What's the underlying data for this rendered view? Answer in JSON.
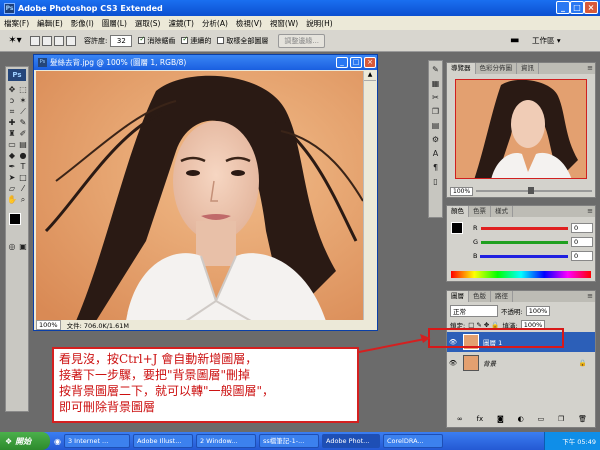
{
  "app": {
    "title": "Adobe Photoshop CS3 Extended",
    "ps_logo": "Ps"
  },
  "menu": [
    "檔案(F)",
    "編輯(E)",
    "影像(I)",
    "圖層(L)",
    "選取(S)",
    "濾鏡(T)",
    "分析(A)",
    "檢視(V)",
    "視窗(W)",
    "說明(H)"
  ],
  "options": {
    "tolerance_label": "容許度:",
    "tolerance_value": "32",
    "antialias_label": "消除鋸齒",
    "contiguous_label": "連續的",
    "sample_all_label": "取樣全部圖層",
    "refine_label": "調整邊緣...",
    "workspace_label": "工作區 ▾"
  },
  "document": {
    "title": "髮絲去背.jpg @ 100% (圖層 1, RGB/8)",
    "zoom": "100%",
    "file_info": "文件: 706.0K/1.61M"
  },
  "navigator": {
    "tabs": [
      "導覽器",
      "色彩分佈圖",
      "資訊"
    ],
    "zoom": "100%"
  },
  "color_panel": {
    "tabs": [
      "顏色",
      "色票",
      "樣式"
    ],
    "channels": [
      {
        "label": "R",
        "value": "0",
        "color": "#e02020"
      },
      {
        "label": "G",
        "value": "0",
        "color": "#20a020"
      },
      {
        "label": "B",
        "value": "0",
        "color": "#2020e0"
      }
    ]
  },
  "layers_panel": {
    "tabs": [
      "圖層",
      "色版",
      "路徑"
    ],
    "blend_mode": "正常",
    "opacity_label": "不透明:",
    "opacity_value": "100%",
    "lock_label": "鎖定:",
    "fill_label": "填滿:",
    "fill_value": "100%",
    "layers": [
      {
        "name": "圖層 1",
        "selected": true
      },
      {
        "name": "背景",
        "selected": false
      }
    ]
  },
  "annotation": {
    "lines": [
      "看見沒，按Ctrl+J 會自動新增圖層，",
      "接著下一步驟，要把\"背景圖層\"刪掉",
      "按背景圖層二下，就可以轉\"一般圖層\"，",
      "即可刪除背景圖層"
    ]
  },
  "taskbar": {
    "start_label": "開始",
    "tasks": [
      {
        "label": "3 Internet ..."
      },
      {
        "label": "Adobe Illust..."
      },
      {
        "label": "2 Window..."
      },
      {
        "label": "ss檔筆記-1-..."
      },
      {
        "label": "Adobe Phot...",
        "active": true
      },
      {
        "label": "CorelDRA..."
      }
    ],
    "clock": "下午 05:49"
  },
  "colors": {
    "titlebar": "#0b4fd0",
    "annotation_red": "#cc1010",
    "layer_selected": "#2c5fb8"
  }
}
